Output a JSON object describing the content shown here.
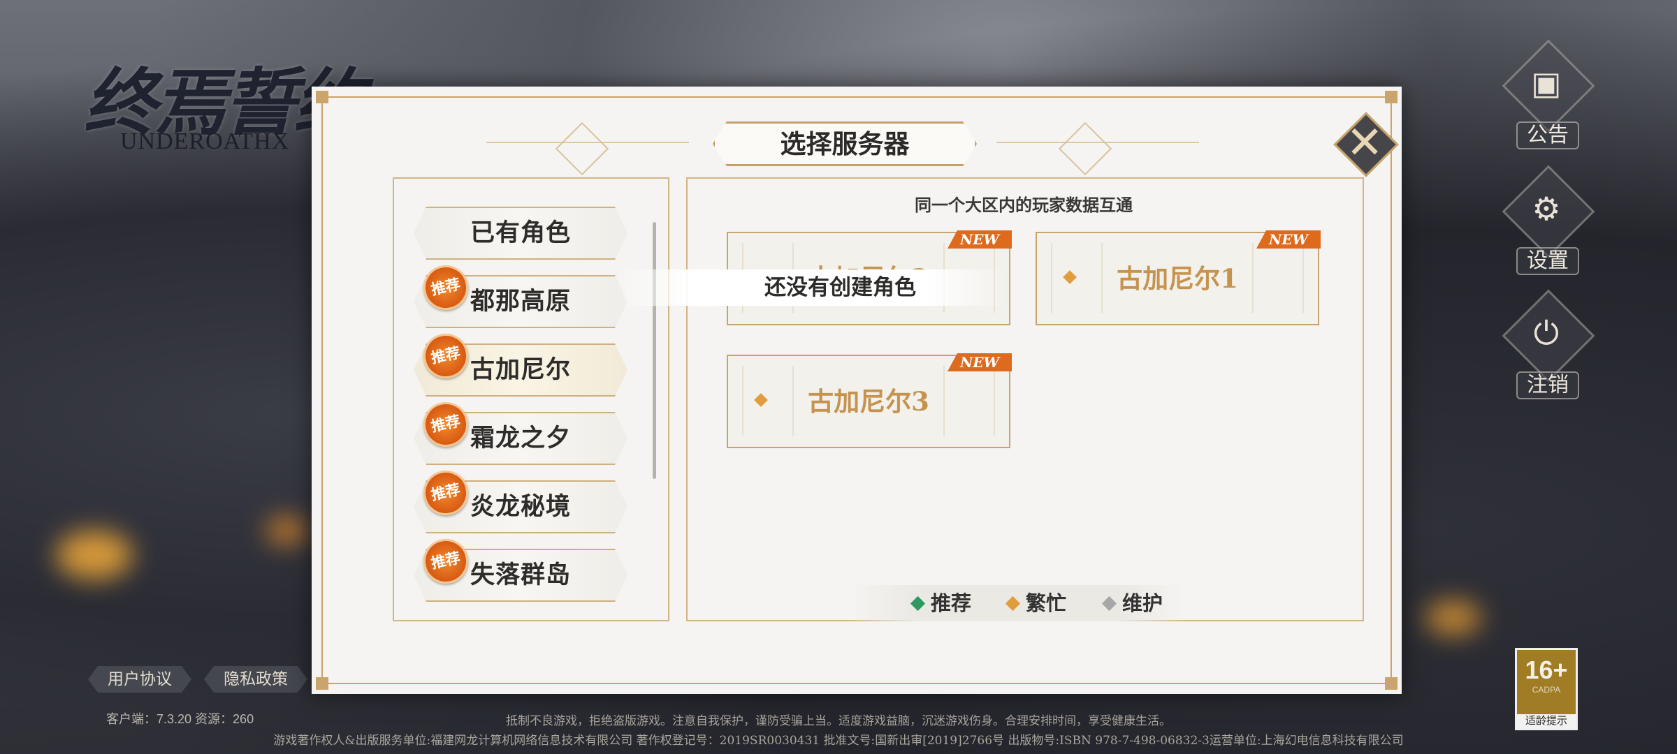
{
  "logo": {
    "title": "终焉誓约",
    "subtitle": "UNDEROATHX"
  },
  "side_buttons": [
    {
      "label": "公告",
      "icon": "announcement-icon"
    },
    {
      "label": "设置",
      "icon": "gear-icon"
    },
    {
      "label": "注销",
      "icon": "power-icon"
    }
  ],
  "dialog": {
    "title": "选择服务器",
    "hint": "同一个大区内的玩家数据互通",
    "toast": "还没有创建角色",
    "close_icon": "close-icon"
  },
  "server_list": [
    {
      "name": "已有角色",
      "badge": ""
    },
    {
      "name": "都那高原",
      "badge": "推荐"
    },
    {
      "name": "古加尼尔",
      "badge": "推荐",
      "selected": true
    },
    {
      "name": "霜龙之夕",
      "badge": "推荐"
    },
    {
      "name": "炎龙秘境",
      "badge": "推荐"
    },
    {
      "name": "失落群岛",
      "badge": "推荐"
    }
  ],
  "server_cards": [
    {
      "name": "古加尼尔2",
      "tag": "NEW",
      "status": "busy"
    },
    {
      "name": "古加尼尔1",
      "tag": "NEW",
      "status": "busy"
    },
    {
      "name": "古加尼尔3",
      "tag": "NEW",
      "status": "busy"
    }
  ],
  "legend": [
    {
      "label": "推荐",
      "color": "#2e9a62"
    },
    {
      "label": "繁忙",
      "color": "#e19c3c"
    },
    {
      "label": "维护",
      "color": "#a7a7a7"
    }
  ],
  "footer": {
    "user_agreement": "用户协议",
    "privacy_policy": "隐私政策",
    "version": "客户端：7.3.20  资源：260",
    "line1": "抵制不良游戏，拒绝盗版游戏。注意自我保护，谨防受骗上当。适度游戏益脑，沉迷游戏伤身。合理安排时间，享受健康生活。",
    "line2": "游戏著作权人&出版服务单位:福建网龙计算机网络信息技术有限公司  著作权登记号：2019SR0030431  批准文号:国新出审[2019]2766号  出版物号:ISBN 978-7-498-06832-3运营单位:上海幻电信息科技有限公司"
  },
  "age_rating": {
    "rating": "16+",
    "org": "CADPA",
    "tip": "适龄提示"
  }
}
